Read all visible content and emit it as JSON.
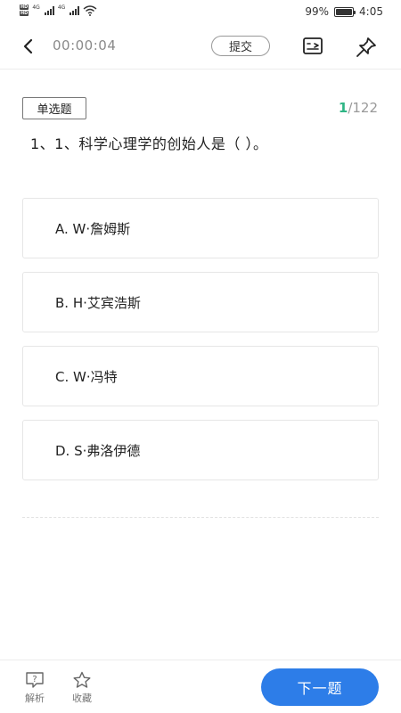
{
  "status_bar": {
    "hd_labels": [
      "HD",
      "HD"
    ],
    "network_labels": [
      "4G",
      "4G"
    ],
    "battery_text": "99%",
    "battery_level": 0.99,
    "time": "4:05",
    "icons": [
      "hd-icon",
      "signal-icon",
      "wifi-icon",
      "battery-icon"
    ]
  },
  "header": {
    "timer": "00:00:04",
    "submit_label": "提交",
    "icons": [
      "back-arrow-icon",
      "answer-sheet-icon",
      "pin-icon"
    ]
  },
  "question": {
    "type_label": "单选题",
    "current": "1",
    "total_suffix": "/122",
    "text": "1、1、科学心理学的创始人是（ ）。",
    "options": [
      {
        "label": "A. W·詹姆斯"
      },
      {
        "label": "B. H·艾宾浩斯"
      },
      {
        "label": "C. W·冯特"
      },
      {
        "label": "D. S·弗洛伊德"
      }
    ]
  },
  "bottom_bar": {
    "analysis_label": "解析",
    "favorite_label": "收藏",
    "next_label": "下一题",
    "accent_color": "#2d7de8"
  },
  "colors": {
    "progress_current": "#2fb585",
    "next_button": "#2d7de8"
  }
}
